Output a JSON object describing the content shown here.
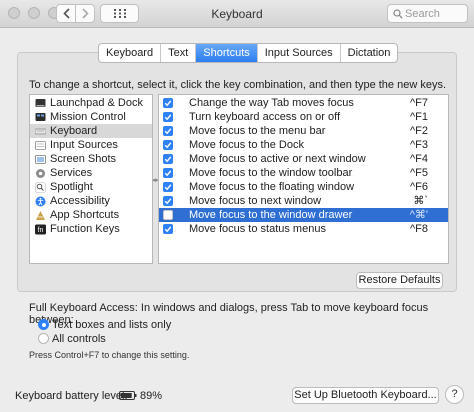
{
  "window": {
    "title": "Keyboard",
    "search_placeholder": "Search"
  },
  "tabs": [
    {
      "label": "Keyboard",
      "active": false
    },
    {
      "label": "Text",
      "active": false
    },
    {
      "label": "Shortcuts",
      "active": true
    },
    {
      "label": "Input Sources",
      "active": false
    },
    {
      "label": "Dictation",
      "active": false
    }
  ],
  "instruction": "To change a shortcut, select it, click the key combination, and then type the new keys.",
  "categories": [
    {
      "label": "Launchpad & Dock",
      "icon": "launchpad-dock-icon",
      "selected": false
    },
    {
      "label": "Mission Control",
      "icon": "mission-control-icon",
      "selected": false
    },
    {
      "label": "Keyboard",
      "icon": "keyboard-icon",
      "selected": true
    },
    {
      "label": "Input Sources",
      "icon": "input-sources-icon",
      "selected": false
    },
    {
      "label": "Screen Shots",
      "icon": "screen-shots-icon",
      "selected": false
    },
    {
      "label": "Services",
      "icon": "services-gear-icon",
      "selected": false
    },
    {
      "label": "Spotlight",
      "icon": "spotlight-icon",
      "selected": false
    },
    {
      "label": "Accessibility",
      "icon": "accessibility-icon",
      "selected": false
    },
    {
      "label": "App Shortcuts",
      "icon": "app-shortcuts-icon",
      "selected": false
    },
    {
      "label": "Function Keys",
      "icon": "function-keys-icon",
      "selected": false
    }
  ],
  "shortcuts": [
    {
      "label": "Change the way Tab moves focus",
      "key": "^F7",
      "checked": true,
      "selected": false
    },
    {
      "label": "Turn keyboard access on or off",
      "key": "^F1",
      "checked": true,
      "selected": false
    },
    {
      "label": "Move focus to the menu bar",
      "key": "^F2",
      "checked": true,
      "selected": false
    },
    {
      "label": "Move focus to the Dock",
      "key": "^F3",
      "checked": true,
      "selected": false
    },
    {
      "label": "Move focus to active or next window",
      "key": "^F4",
      "checked": true,
      "selected": false
    },
    {
      "label": "Move focus to the window toolbar",
      "key": "^F5",
      "checked": true,
      "selected": false
    },
    {
      "label": "Move focus to the floating window",
      "key": "^F6",
      "checked": true,
      "selected": false
    },
    {
      "label": "Move focus to next window",
      "key": "⌘`",
      "checked": true,
      "selected": false
    },
    {
      "label": "Move focus to the window drawer",
      "key": "^⌘'",
      "checked": false,
      "selected": true
    },
    {
      "label": "Move focus to status menus",
      "key": "^F8",
      "checked": true,
      "selected": false
    }
  ],
  "restore_defaults_label": "Restore Defaults",
  "full_keyboard_access": {
    "label": "Full Keyboard Access: In windows and dialogs, press Tab to move keyboard focus between:",
    "options": [
      {
        "label": "Text boxes and lists only",
        "selected": true
      },
      {
        "label": "All controls",
        "selected": false
      }
    ],
    "hint": "Press Control+F7 to change this setting."
  },
  "battery": {
    "label": "Keyboard battery level:",
    "value": "89%",
    "level": 0.89
  },
  "bluetooth_button_label": "Set Up Bluetooth Keyboard...",
  "help_label": "?",
  "colors": {
    "accent": "#2e81f6",
    "selection": "#2f6ed3"
  }
}
